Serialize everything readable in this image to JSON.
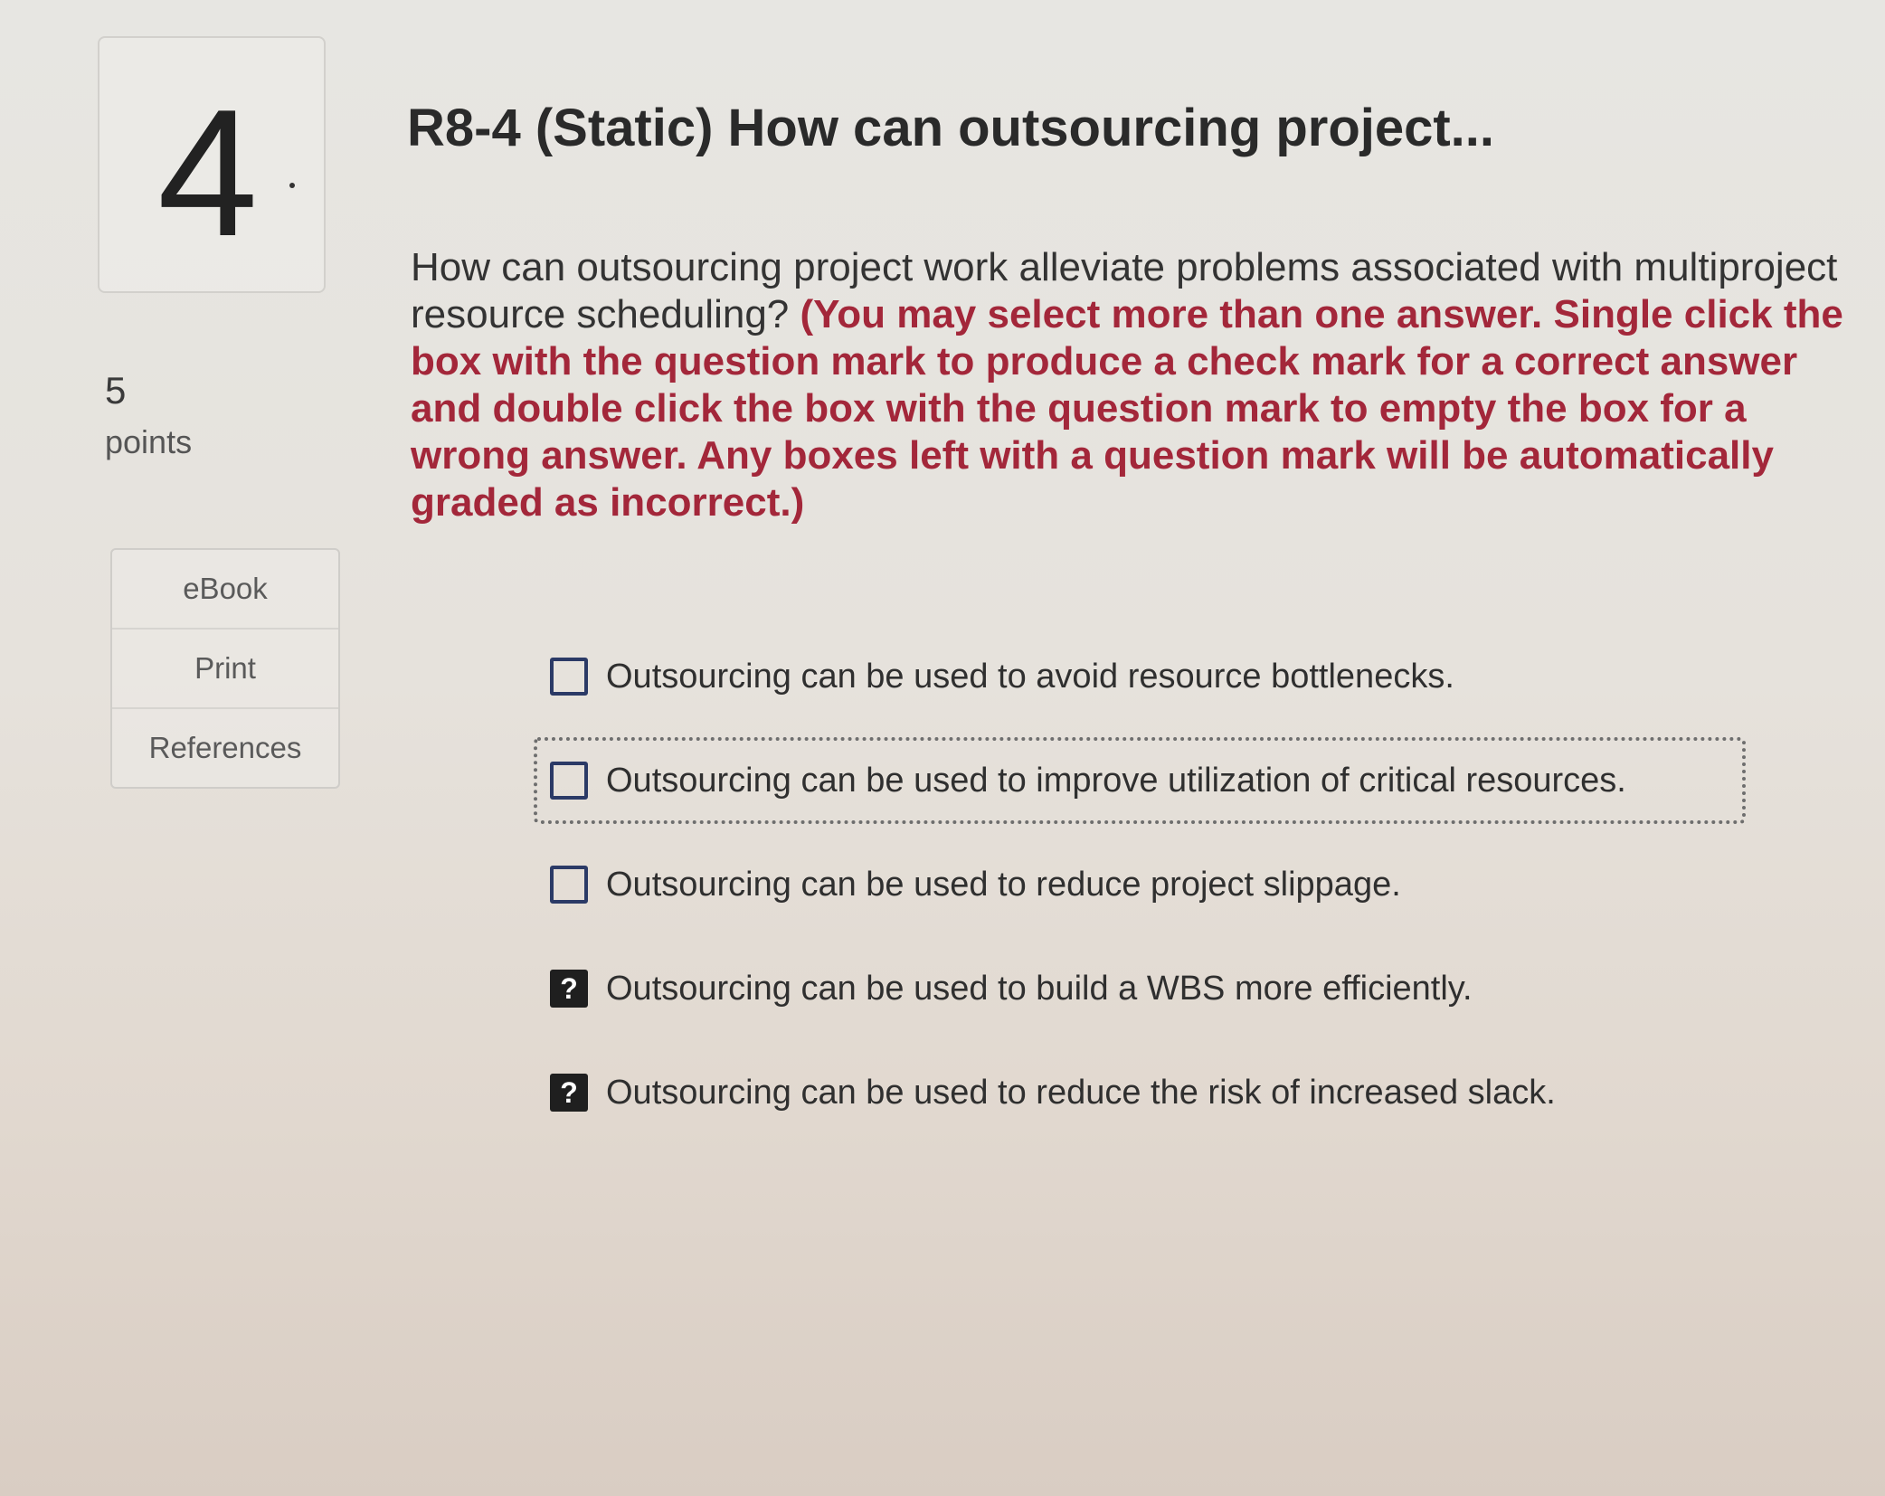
{
  "question": {
    "number": "4",
    "points_value": "5",
    "points_label": "points",
    "title": "R8-4 (Static) How can outsourcing project...",
    "prompt": "How can outsourcing project work alleviate problems associated with multiproject resource scheduling? ",
    "instruction": "(You may select more than one answer. Single click the box with the question mark to produce a check mark for a correct answer and double click the box with the question mark to empty the box for a wrong answer. Any boxes left with a question mark will be automatically graded as incorrect.)"
  },
  "sidebar": {
    "items": [
      {
        "label": "eBook"
      },
      {
        "label": "Print"
      },
      {
        "label": "References"
      }
    ]
  },
  "answers": [
    {
      "text": "Outsourcing can be used to avoid resource bottlenecks.",
      "state": "empty",
      "symbol": ""
    },
    {
      "text": "Outsourcing can be used to improve utilization of critical resources.",
      "state": "empty",
      "symbol": ""
    },
    {
      "text": "Outsourcing can be used to reduce project slippage.",
      "state": "empty",
      "symbol": ""
    },
    {
      "text": "Outsourcing can be used to build a WBS more efficiently.",
      "state": "unanswered",
      "symbol": "?"
    },
    {
      "text": "Outsourcing can be used to reduce the risk of increased slack.",
      "state": "unanswered",
      "symbol": "?"
    }
  ],
  "colors": {
    "instruction_red": "#a3273a",
    "checkbox_border": "#2b3a66",
    "question_box_fill": "#1f1f1f"
  },
  "icons": {
    "empty_box": "empty-checkbox-icon",
    "unanswered_box": "question-mark-icon"
  }
}
